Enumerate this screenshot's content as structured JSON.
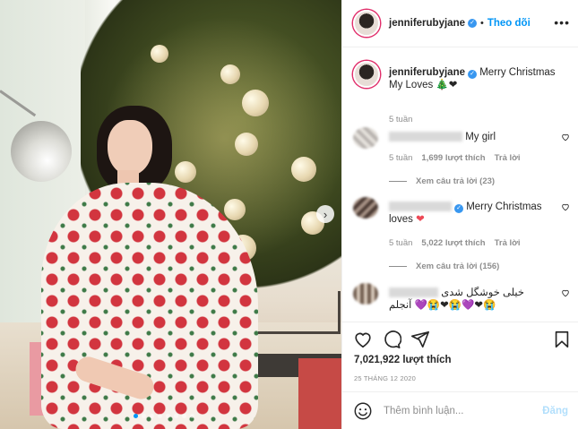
{
  "post": {
    "username": "jenniferubyjane",
    "follow_label": "Theo dõi",
    "more_label": "•••"
  },
  "caption": {
    "username": "jenniferubyjane",
    "text": "Merry Christmas My Loves",
    "emojis": "🎄❤",
    "time": "5 tuần"
  },
  "comments": [
    {
      "text": "My girl",
      "time": "5 tuần",
      "likes": "1,699 lượt thích",
      "reply_label": "Trả lời",
      "view_replies": ""
    },
    {
      "text": "Merry Christmas loves",
      "emoji": "❤",
      "time": "5 tuần",
      "likes": "5,022 lượt thích",
      "reply_label": "Trả lời",
      "view_replies": "Xem câu trả lời (156)"
    },
    {
      "text": "خیلی خوشگل شدی",
      "line2": "آنجلم",
      "emojis": "😭❤💜😭❤😭💜",
      "time": "",
      "likes": "",
      "reply_label": "",
      "view_replies": ""
    }
  ],
  "view_replies_first": "Xem câu trả lời (23)",
  "stats": {
    "likes": "7,021,922 lượt thích",
    "date": "25 THÁNG 12 2020"
  },
  "composer": {
    "placeholder": "Thêm bình luận...",
    "post_label": "Đăng"
  },
  "colors": {
    "accent": "#0095f6",
    "verified": "#3897f0",
    "heart": "#ed4956",
    "muted": "#8e8e8e"
  },
  "icons": {
    "header_more": "more-icon",
    "verified": "verified-badge-icon",
    "comment_like": "heart-outline-icon",
    "like": "heart-outline-icon",
    "comment": "comment-bubble-icon",
    "share": "paper-plane-icon",
    "save": "bookmark-icon",
    "emoji": "smiley-icon",
    "carousel_next": "chevron-right-icon"
  }
}
